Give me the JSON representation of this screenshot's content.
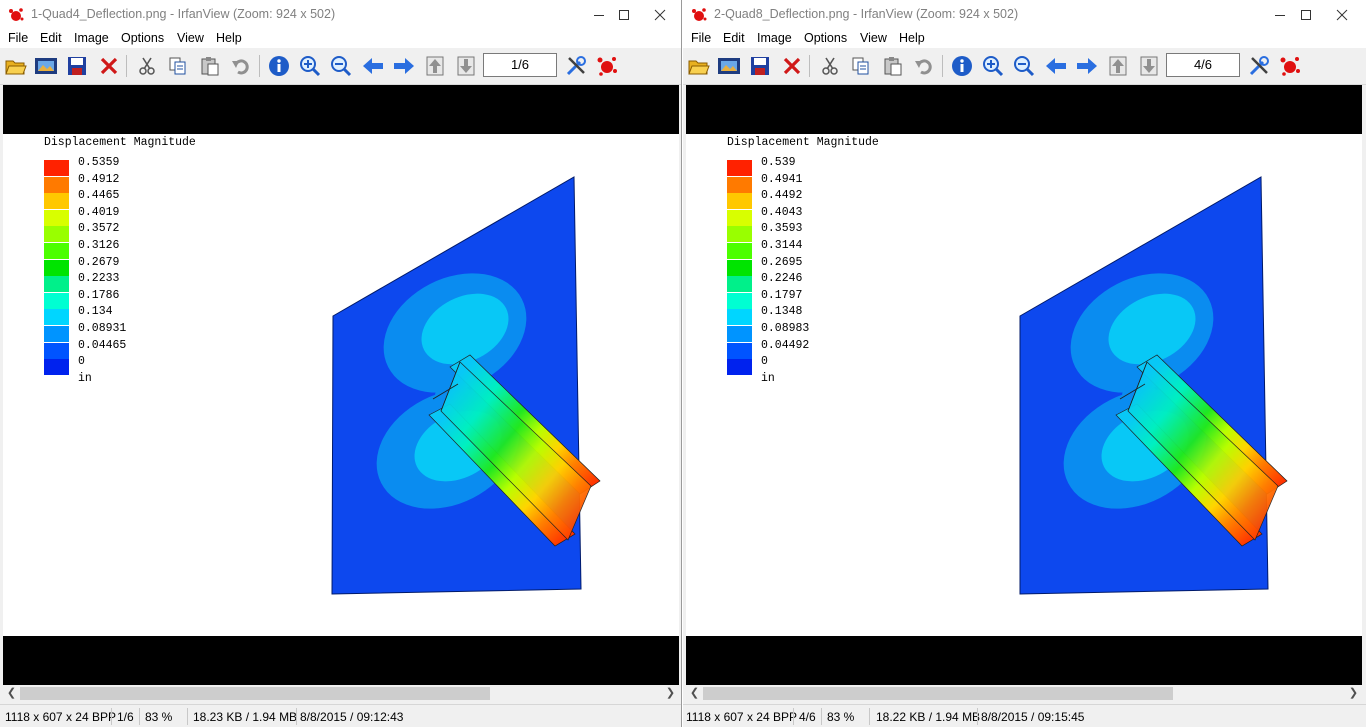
{
  "left": {
    "title": "1-Quad4_Deflection.png - IrfanView (Zoom: 924 x 502)",
    "page": "1/6",
    "legend_title": "Displacement Magnitude",
    "legend_values": [
      "0.5359",
      "0.4912",
      "0.4465",
      "0.4019",
      "0.3572",
      "0.3126",
      "0.2679",
      "0.2233",
      "0.1786",
      "0.134",
      "0.08931",
      "0.04465",
      "0"
    ],
    "unit": "in",
    "status": {
      "dims": "1118 x 607 x 24 BPP",
      "page": "1/6",
      "zoom": "83 %",
      "size": "18.23 KB / 1.94 MB",
      "datetime": "8/8/2015 / 09:12:43"
    }
  },
  "right": {
    "title": "2-Quad8_Deflection.png - IrfanView (Zoom: 924 x 502)",
    "page": "4/6",
    "legend_title": "Displacement Magnitude",
    "legend_values": [
      "0.539",
      "0.4941",
      "0.4492",
      "0.4043",
      "0.3593",
      "0.3144",
      "0.2695",
      "0.2246",
      "0.1797",
      "0.1348",
      "0.08983",
      "0.04492",
      "0"
    ],
    "unit": "in",
    "status": {
      "dims": "1118 x 607 x 24 BPP",
      "page": "4/6",
      "zoom": "83 %",
      "size": "18.22 KB / 1.94 MB",
      "datetime": "8/8/2015 / 09:15:45"
    }
  },
  "menu": [
    "File",
    "Edit",
    "Image",
    "Options",
    "View",
    "Help"
  ],
  "toolbar_icons": [
    "open-icon",
    "slideshow-icon",
    "save-icon",
    "delete-icon",
    "cut-icon",
    "copy-icon",
    "paste-icon",
    "undo-icon",
    "info-icon",
    "zoom-in-icon",
    "zoom-out-icon",
    "previous-icon",
    "next-icon",
    "first-page-icon",
    "last-page-icon",
    "settings-icon",
    "irfanview-icon"
  ],
  "legend_colors": [
    "#ff2200",
    "#ff7a00",
    "#ffc800",
    "#d8ff00",
    "#99ff00",
    "#4cff00",
    "#00e400",
    "#00f08a",
    "#00ffd2",
    "#00d6ff",
    "#0094ff",
    "#0054ff",
    "#0022ee"
  ],
  "colors": {
    "plate": "#0d48ee",
    "ring_mid": "#0a8cf0",
    "ring_inner": "#08c8f6",
    "beam_hot": "#ff3a00"
  }
}
